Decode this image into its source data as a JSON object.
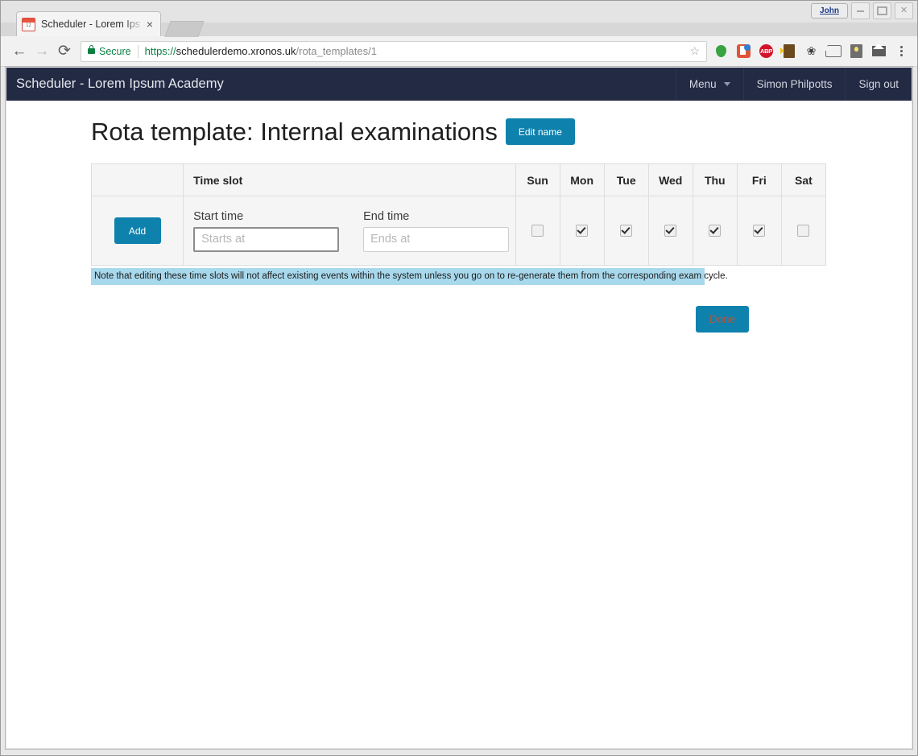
{
  "window": {
    "user_chip": "John",
    "minimize_label": "Minimize",
    "maximize_label": "Maximize",
    "close_label": "Close"
  },
  "browser": {
    "tab": {
      "title": "Scheduler - Lorem Ips",
      "favicon_date": "12",
      "close_label": "×"
    },
    "new_tab_label": "",
    "back_label": "←",
    "forward_label": "→",
    "reload_label": "⟳",
    "omnibox": {
      "security_label": "Secure",
      "url_scheme": "https://",
      "url_host": "schedulerdemo.xronos.uk",
      "url_path": "/rota_templates/1",
      "full_url": "https://schedulerdemo.xronos.uk/rota_templates/1",
      "star_glyph": "☆"
    },
    "extensions": [
      {
        "name": "balloon-extension-icon"
      },
      {
        "name": "bookmark-extension-icon"
      },
      {
        "name": "adblock-plus-icon",
        "label": "ABP"
      },
      {
        "name": "door-extension-icon"
      },
      {
        "name": "claw-extension-icon",
        "glyph": "❀"
      },
      {
        "name": "cast-icon"
      },
      {
        "name": "note-extension-icon"
      },
      {
        "name": "mail-extension-icon"
      }
    ]
  },
  "app": {
    "brand": "Scheduler - Lorem Ipsum Academy",
    "nav": {
      "menu_label": "Menu",
      "user_label": "Simon Philpotts",
      "signout_label": "Sign out"
    }
  },
  "page": {
    "title": "Rota template: Internal examinations",
    "edit_name_label": "Edit name",
    "note": "Note that editing these time slots will not affect existing events within the system unless you go on to re-generate them from the corresponding exam cycle.",
    "done_label": "Done"
  },
  "table": {
    "headers": {
      "actions": "",
      "time_slot": "Time slot",
      "days": [
        "Sun",
        "Mon",
        "Tue",
        "Wed",
        "Thu",
        "Fri",
        "Sat"
      ]
    },
    "row": {
      "add_label": "Add",
      "start_label": "Start time",
      "start_placeholder": "Starts at",
      "start_value": "",
      "end_label": "End time",
      "end_placeholder": "Ends at",
      "end_value": "",
      "day_checked": [
        false,
        true,
        true,
        true,
        true,
        true,
        false
      ]
    }
  },
  "colors": {
    "navbar_bg": "#222a44",
    "accent_blue": "#0e81ad",
    "note_bg": "#a8d8ec",
    "secure_green": "#0b8043"
  }
}
